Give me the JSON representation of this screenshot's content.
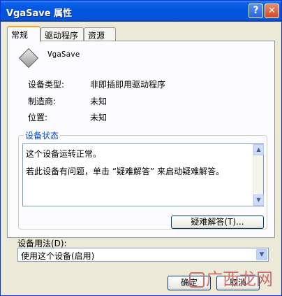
{
  "window": {
    "title": "VgaSave 属性",
    "help_glyph": "?",
    "close_glyph": "✕"
  },
  "tabs": [
    {
      "label": "常规",
      "active": true
    },
    {
      "label": "驱动程序",
      "active": false
    },
    {
      "label": "资源",
      "active": false
    }
  ],
  "device": {
    "icon": "device-diamond-icon",
    "name": "VgaSave"
  },
  "properties": [
    {
      "label": "设备类型:",
      "value": "非即插即用驱动程序"
    },
    {
      "label": "制造商:",
      "value": "未知"
    },
    {
      "label": "位置:",
      "value": "未知"
    }
  ],
  "status": {
    "title": "设备状态",
    "lines": [
      "这个设备运转正常。",
      "若此设备有问题，单击 “疑难解答” 来启动疑难解答。"
    ],
    "troubleshoot_label": "疑难解答(T)..."
  },
  "usage": {
    "label": "设备用法(D):",
    "value": "使用这个设备(启用)"
  },
  "buttons": {
    "ok": "确定",
    "cancel": "取消"
  },
  "watermark": {
    "text": "广西龙网"
  },
  "colors": {
    "title_bar": "#0253df",
    "group_title": "#0046d5",
    "tab_highlight": "#f5a623"
  }
}
